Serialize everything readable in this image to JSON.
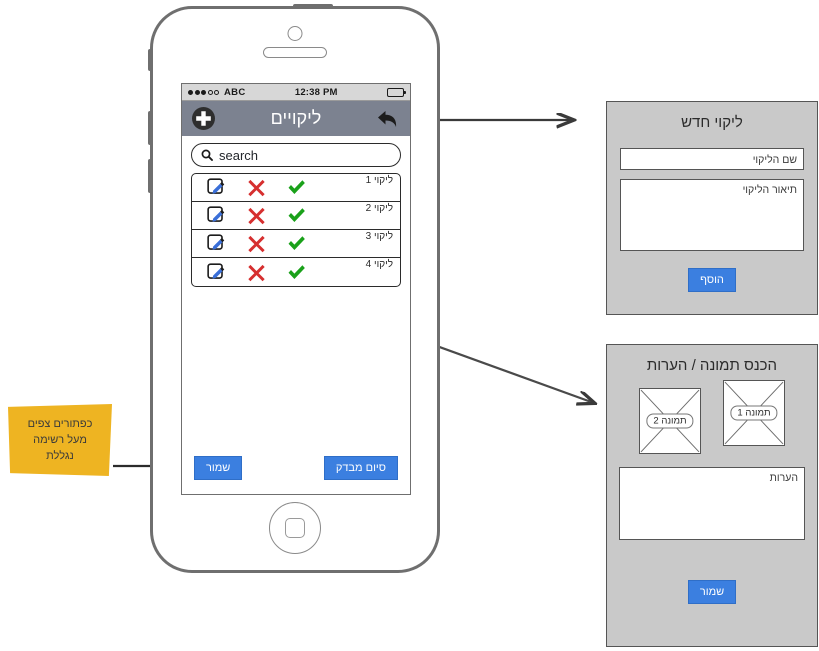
{
  "phone": {
    "status_bar": {
      "signal_filled": 3,
      "signal_total": 5,
      "carrier": "ABC",
      "time": "12:38 PM",
      "battery_icon": "battery-icon"
    },
    "nav": {
      "back_icon": "back-arrow-icon",
      "title": "ליקויים",
      "add_icon": "plus-circle-icon"
    },
    "search": {
      "icon": "search-icon",
      "placeholder": "search"
    },
    "defects": [
      {
        "label": "ליקוי 1"
      },
      {
        "label": "ליקוי 2"
      },
      {
        "label": "ליקוי 3"
      },
      {
        "label": "ליקוי 4"
      }
    ],
    "row_actions": {
      "edit_icon": "edit-pencil-icon",
      "reject_icon": "red-x-icon",
      "approve_icon": "green-check-icon"
    },
    "buttons": {
      "save": "שמור",
      "finish_audit": "סיום מבדק"
    }
  },
  "panel_new_defect": {
    "title": "ליקוי חדש",
    "name_placeholder": "שם הליקוי",
    "description_placeholder": "תיאור הליקוי",
    "add_button": "הוסף"
  },
  "panel_image_notes": {
    "title": "הכנס תמונה / הערות",
    "images": [
      {
        "label": "תמונה 1"
      },
      {
        "label": "תמונה 2"
      }
    ],
    "notes_placeholder": "הערות",
    "save_button": "שמור"
  },
  "sticky_note": {
    "line1": "כפתורים צפים",
    "line2": "מעל רשימה",
    "line3": "נגללת"
  },
  "colors": {
    "nav_bar": "#7c8290",
    "button_blue": "#3b7fe0",
    "panel_gray": "#c9c9c9",
    "sticky_yellow": "#eeb422",
    "reject_red": "#d62f2f",
    "approve_green": "#1aa11a",
    "frame_gray": "#6f6f6f"
  }
}
